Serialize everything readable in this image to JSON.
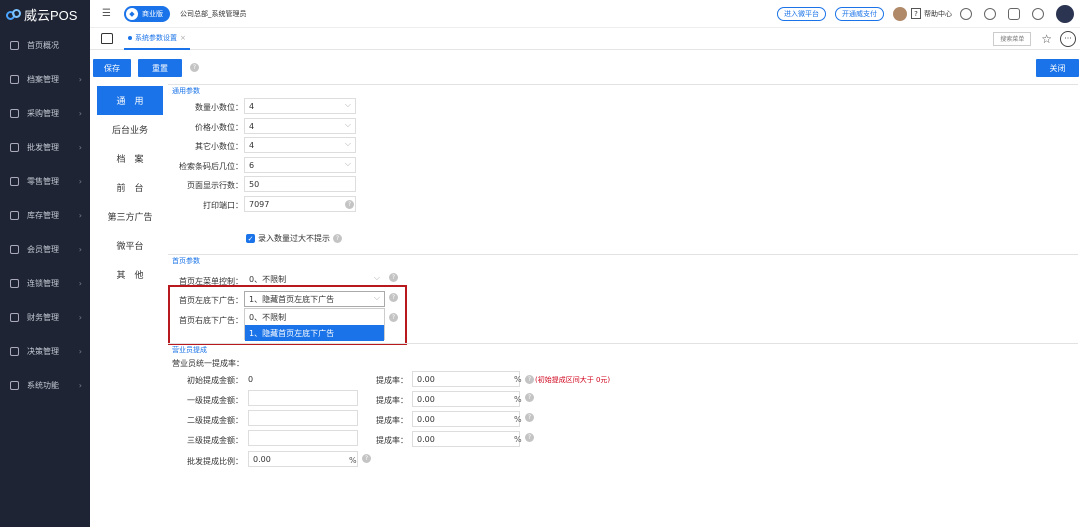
{
  "brand": {
    "name": "威云POS"
  },
  "sidebar": {
    "items": [
      {
        "label": "首页概况"
      },
      {
        "label": "档案管理"
      },
      {
        "label": "采购管理"
      },
      {
        "label": "批发管理"
      },
      {
        "label": "零售管理"
      },
      {
        "label": "库存管理"
      },
      {
        "label": "会员管理"
      },
      {
        "label": "连锁管理"
      },
      {
        "label": "财务管理"
      },
      {
        "label": "决策管理"
      },
      {
        "label": "系统功能"
      }
    ]
  },
  "topbar": {
    "badge": "商业版",
    "company": "公司总部_系统管理员",
    "link1": "进入微平台",
    "link2": "开通威支付",
    "help_icon": "?",
    "help_label": "帮助中心"
  },
  "tabs": {
    "active": "系统参数设置",
    "close": "×",
    "search_label": "搜索菜单"
  },
  "actions": {
    "save": "保存",
    "reset": "重置",
    "close": "关闭"
  },
  "left_tabs": [
    {
      "label": "通　用"
    },
    {
      "label": "后台业务"
    },
    {
      "label": "档　案"
    },
    {
      "label": "前　台"
    },
    {
      "label": "第三方广告"
    },
    {
      "label": "微平台"
    },
    {
      "label": "其　他"
    }
  ],
  "general": {
    "title": "通用参数",
    "fields": [
      {
        "label": "数量小数位：",
        "value": "4"
      },
      {
        "label": "价格小数位：",
        "value": "4"
      },
      {
        "label": "其它小数位：",
        "value": "4"
      },
      {
        "label": "检索条码后几位：",
        "value": "6"
      },
      {
        "label": "页面显示行数：",
        "value": "50"
      },
      {
        "label": "打印端口：",
        "value": "7097"
      }
    ],
    "checkbox": "录入数量过大不提示",
    "check_mark": "✓"
  },
  "homepage": {
    "title": "首页参数",
    "left_menu_label": "首页左菜单控制：",
    "left_menu_value": "0、不限制",
    "left_ad_label": "首页左底下广告：",
    "left_ad_value": "1、隐藏首页左底下广告",
    "right_ad_label": "首页右底下广告：",
    "options": [
      "0、不限制",
      "1、隐藏首页左底下广告"
    ]
  },
  "commission": {
    "title": "营业员提成",
    "heading": "营业员统一提成率：",
    "initial_label": "初始提成金额：",
    "initial_value": "0",
    "tiers": [
      {
        "label": "一级提成金额："
      },
      {
        "label": "二级提成金额："
      },
      {
        "label": "三级提成金额："
      }
    ],
    "rate_label": "提成率：",
    "rate_value": "0.00",
    "pct": "%",
    "note": "(初始提成区间大于 0元)",
    "wholesale_label": "批发提成比例：",
    "wholesale_value": "0.00"
  },
  "colors": {
    "accent": "#1a73e8",
    "sidebar": "#1e2433",
    "highlight": "#b8191f",
    "warning": "#d0021b"
  },
  "icons": [
    "logo-icon",
    "menu-fold-icon",
    "diamond-icon",
    "avatar-icon",
    "question-icon",
    "info-icon",
    "bell-icon",
    "lock-icon",
    "power-icon",
    "cloud-icon",
    "home-icon",
    "star-icon",
    "more-icon",
    "chevron-down-icon",
    "checkbox-icon",
    "help-icon"
  ]
}
